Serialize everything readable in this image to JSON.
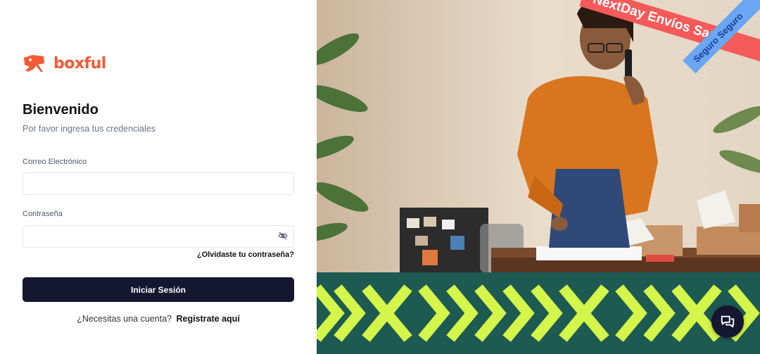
{
  "brand": {
    "name": "boxful",
    "color": "#f25a35"
  },
  "login": {
    "title": "Bienvenido",
    "subtitle": "Por favor ingresa tus credenciales",
    "email_label": "Correo Electrónico",
    "email_value": "",
    "password_label": "Contraseña",
    "password_value": "",
    "forgot_link": "¿Olvidaste tu contraseña?",
    "submit_label": "Iniciar Sesión",
    "signup_prompt": "¿Necesitas una cuenta?",
    "signup_link": "Registrate aquí"
  },
  "hero": {
    "ribbon_red": "NextDay  Envíos Same",
    "ribbon_blue": "Seguro  Seguro",
    "band_color": "#1d5a52",
    "chevron_color": "#d4f54a"
  },
  "icons": {
    "logo": "delivery-mascot-icon",
    "password_toggle": "eye-off-icon",
    "chat": "chat-bubbles-icon"
  },
  "colors": {
    "primary": "#15162f",
    "accent": "#f25a35"
  }
}
